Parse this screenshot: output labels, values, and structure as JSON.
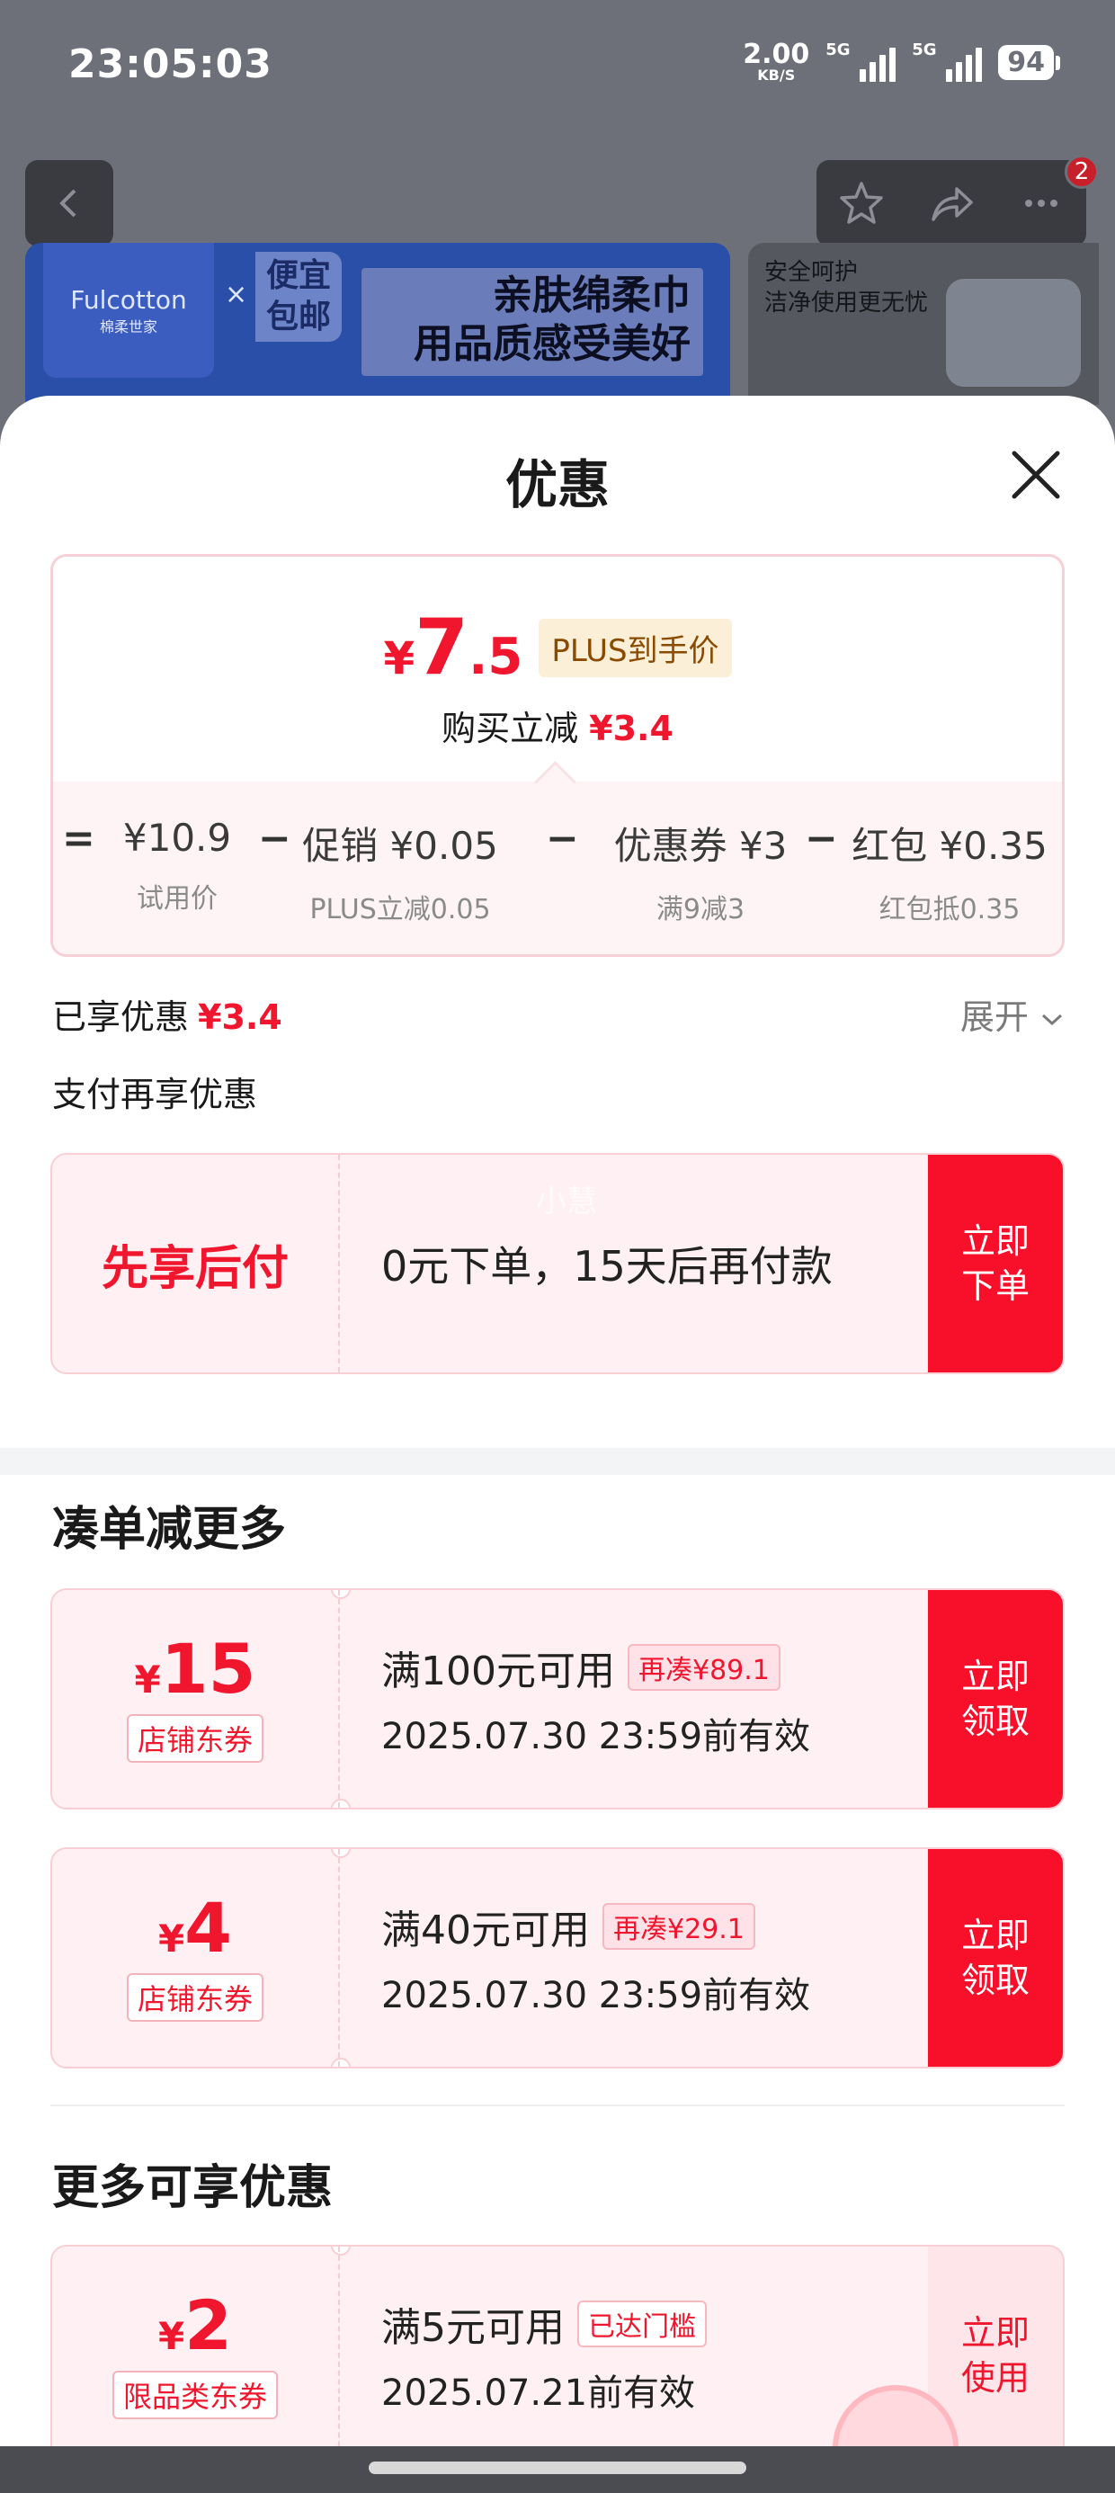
{
  "status_bar": {
    "time": "23:05:03",
    "net_speed": "2.00",
    "net_unit": "KB/S",
    "sim1": "5G",
    "sim2": "5G",
    "battery": "94"
  },
  "background_page": {
    "notification_count": "2",
    "banner_brand": "Fulcotton",
    "banner_brand_cn": "棉柔世家",
    "banner_tag": "便宜包邮",
    "banner_tag_line1": "便宜",
    "banner_tag_line2": "包邮",
    "banner_headline_line1": "亲肤绵柔巾",
    "banner_headline_line2": "用品质感受美好",
    "side_banner_line1": "安全呵护",
    "side_banner_line2": "洁净使用更无忧"
  },
  "sheet": {
    "title": "优惠",
    "summary": {
      "currency": "¥",
      "final_int": "7",
      "final_dec": ".5",
      "plus_tag": "PLUS到手价",
      "saving_label": "购买立减",
      "saving_amount": "¥3.4",
      "formula": [
        {
          "op": "=",
          "amount": "¥10.9",
          "label": "试用价"
        },
        {
          "op": "−",
          "amount": "促销 ¥0.05",
          "label": "PLUS立减0.05"
        },
        {
          "op": "−",
          "amount": "优惠券 ¥3",
          "label": "满9减3"
        },
        {
          "op": "−",
          "amount": "红包 ¥0.35",
          "label": "红包抵0.35"
        }
      ]
    },
    "enjoyed_label": "已享优惠",
    "enjoyed_amount": "¥3.4",
    "expand_label": "展开",
    "pay_section_title": "支付再享优惠",
    "bnpl": {
      "label": "先享后付",
      "text": "0元下单，15天后再付款",
      "watermark": "小慧",
      "button_line1": "立即",
      "button_line2": "下单"
    },
    "combine_title": "凑单减更多",
    "combine_coupons": [
      {
        "currency": "¥",
        "amount": "15",
        "type": "店铺东券",
        "condition": "满100元可用",
        "badge": "再凑¥89.1",
        "expiry": "2025.07.30 23:59前有效",
        "btn1": "立即",
        "btn2": "领取"
      },
      {
        "currency": "¥",
        "amount": "4",
        "type": "店铺东券",
        "condition": "满40元可用",
        "badge": "再凑¥29.1",
        "expiry": "2025.07.30 23:59前有效",
        "btn1": "立即",
        "btn2": "领取"
      }
    ],
    "more_title": "更多可享优惠",
    "more_coupons": [
      {
        "currency": "¥",
        "amount": "2",
        "type": "限品类东券",
        "condition": "满5元可用",
        "badge": "已达门槛",
        "expiry": "2025.07.21前有效",
        "btn1": "立即",
        "btn2": "使用"
      }
    ]
  },
  "colors": {
    "accent_red": "#f0162d",
    "button_red": "#f8102b",
    "plus_tag_bg": "#fcefd8",
    "overlay": "#6e7079"
  }
}
